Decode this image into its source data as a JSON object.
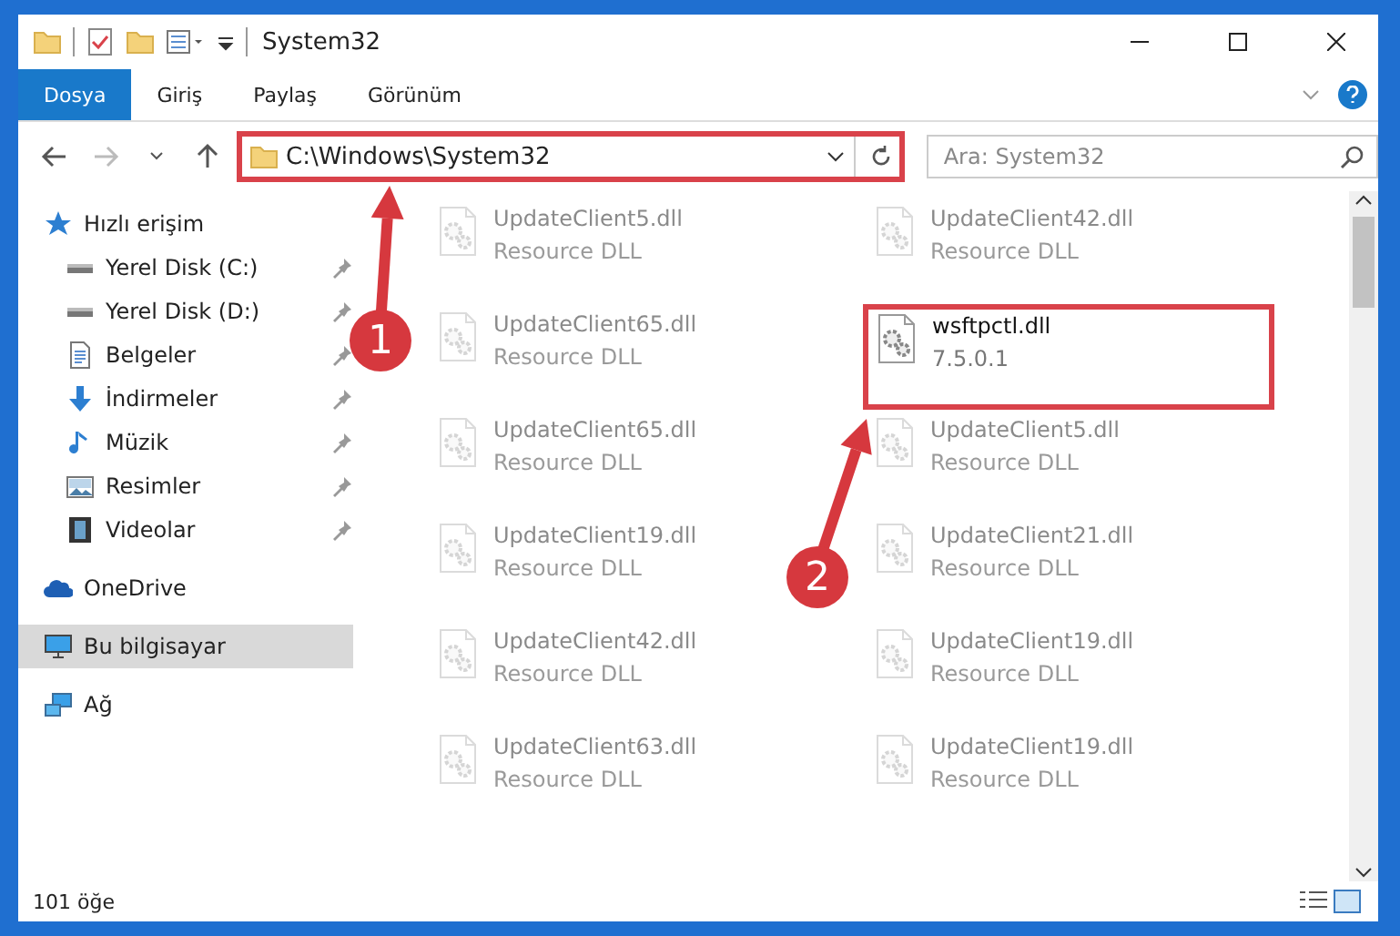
{
  "window": {
    "title": "System32"
  },
  "ribbon": {
    "tabs": [
      {
        "label": "Dosya",
        "selected": true
      },
      {
        "label": "Giriş",
        "selected": false
      },
      {
        "label": "Paylaş",
        "selected": false
      },
      {
        "label": "Görünüm",
        "selected": false
      }
    ]
  },
  "address_bar": {
    "path": "C:\\Windows\\System32",
    "highlighted": true
  },
  "search": {
    "placeholder": "Ara: System32"
  },
  "sidebar": {
    "items": [
      {
        "label": "Hızlı erişim",
        "kind": "star",
        "selected": false,
        "children": [
          {
            "label": "Yerel Disk (C:)",
            "kind": "drive",
            "selected": false,
            "pinned": true
          },
          {
            "label": "Yerel Disk (D:)",
            "kind": "drive",
            "selected": false,
            "pinned": true
          },
          {
            "label": "Belgeler",
            "kind": "document",
            "selected": false,
            "pinned": true
          },
          {
            "label": "İndirmeler",
            "kind": "download",
            "selected": false,
            "pinned": true
          },
          {
            "label": "Müzik",
            "kind": "music",
            "selected": false,
            "pinned": true
          },
          {
            "label": "Resimler",
            "kind": "picture",
            "selected": false,
            "pinned": true
          },
          {
            "label": "Videolar",
            "kind": "video",
            "selected": false,
            "pinned": true
          }
        ]
      },
      {
        "label": "OneDrive",
        "kind": "cloud",
        "selected": false
      },
      {
        "label": "Bu bilgisayar",
        "kind": "computer",
        "selected": true
      },
      {
        "label": "Ağ",
        "kind": "network",
        "selected": false
      }
    ]
  },
  "files": [
    {
      "name": "UpdateClient5.dll",
      "detail": "Resource DLL",
      "faded": true,
      "highlighted": false
    },
    {
      "name": "UpdateClient42.dll",
      "detail": "Resource DLL",
      "faded": true,
      "highlighted": false
    },
    {
      "name": "UpdateClient65.dll",
      "detail": "Resource DLL",
      "faded": true,
      "highlighted": false
    },
    {
      "name": "wsftpctl.dll",
      "detail": "7.5.0.1",
      "faded": false,
      "highlighted": true
    },
    {
      "name": "UpdateClient65.dll",
      "detail": "Resource DLL",
      "faded": true,
      "highlighted": false
    },
    {
      "name": "UpdateClient5.dll",
      "detail": "Resource DLL",
      "faded": true,
      "highlighted": false
    },
    {
      "name": "UpdateClient19.dll",
      "detail": "Resource DLL",
      "faded": true,
      "highlighted": false
    },
    {
      "name": "UpdateClient21.dll",
      "detail": "Resource DLL",
      "faded": true,
      "highlighted": false
    },
    {
      "name": "UpdateClient42.dll",
      "detail": "Resource DLL",
      "faded": true,
      "highlighted": false
    },
    {
      "name": "UpdateClient19.dll",
      "detail": "Resource DLL",
      "faded": true,
      "highlighted": false
    },
    {
      "name": "UpdateClient63.dll",
      "detail": "Resource DLL",
      "faded": true,
      "highlighted": false
    },
    {
      "name": "UpdateClient19.dll",
      "detail": "Resource DLL",
      "faded": true,
      "highlighted": false
    }
  ],
  "status_bar": {
    "item_count": "101 öğe"
  },
  "annotations": [
    {
      "label": "1"
    },
    {
      "label": "2"
    }
  ]
}
